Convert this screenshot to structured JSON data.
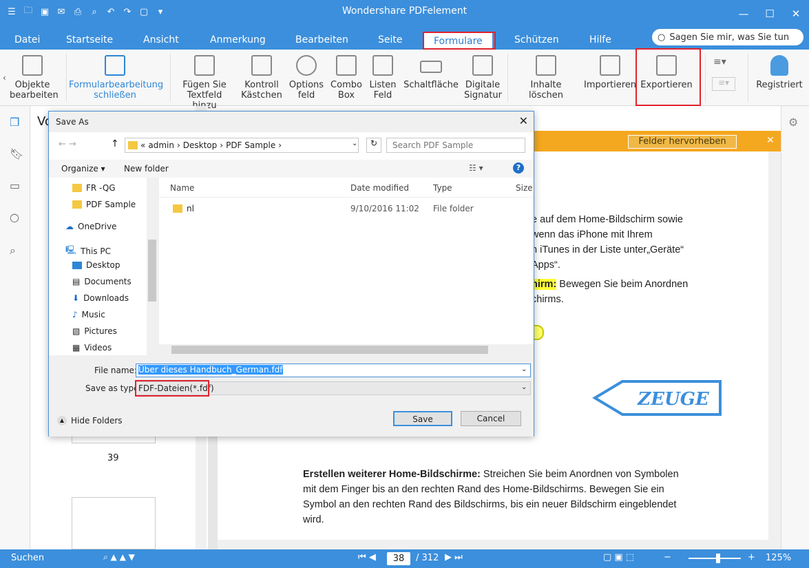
{
  "app": {
    "title": "Wondershare PDFelement",
    "tabs": [
      "Datei",
      "Startseite",
      "Ansicht",
      "Anmerkung",
      "Bearbeiten",
      "Seite",
      "Formulare",
      "Schützen",
      "Hilfe"
    ],
    "active_tab": "Formulare",
    "help_search_placeholder": "Sagen Sie mir, was Sie tun"
  },
  "ribbon": {
    "objekte": "Objekte bearbeiten",
    "formular_close": "Formularbearbeitung schließen",
    "textfeld": "Fügen Sie Textfeld hinzu",
    "kontroll": "Kontroll Kästchen",
    "options": "Options feld",
    "combo": "Combo Box",
    "listen": "Listen Feld",
    "schalt": "Schaltfläche",
    "signatur": "Digitale Signatur",
    "inhalte": "Inhalte löschen",
    "importieren": "Importieren",
    "exportieren": "Exportieren",
    "registriert": "Registriert"
  },
  "highlight_button": "Felder hervorheben",
  "thumbs": {
    "title": "Vo",
    "page_number": "39"
  },
  "doc": {
    "line1": "e auf dem Home-Bildschirm sowie",
    "line2": "wenn das iPhone mit Ihrem",
    "line3": "n iTunes in der Liste unter„Geräte“",
    "line4": "Apps“.",
    "line5_h": "hirm:",
    "line5": " Bewegen Sie beim Anordnen",
    "line6": "chirms.",
    "stamp": "ZEUGE",
    "para_bold": "Erstellen weiterer Home-Bildschirme:",
    "para1": " Streichen Sie beim Anordnen von Symbolen",
    "para2": "mit dem Finger bis an den rechten Rand des Home-Bildschirms. Bewegen Sie ein",
    "para3": "Symbol an den rechten Rand des Bildschirms, bis ein neuer Bildschirm eingeblendet",
    "para4": "wird."
  },
  "status": {
    "search": "Suchen",
    "page": "38",
    "total": "/ 312",
    "zoom": "125%"
  },
  "dialog": {
    "title": "Save As",
    "path": [
      "admin",
      "Desktop",
      "PDF Sample"
    ],
    "search_placeholder": "Search PDF Sample",
    "organize": "Organize",
    "new_folder": "New folder",
    "nav": [
      "FR -QG",
      "PDF Sample",
      "OneDrive",
      "This PC",
      "Desktop",
      "Documents",
      "Downloads",
      "Music",
      "Pictures",
      "Videos"
    ],
    "columns": [
      "Name",
      "Date modified",
      "Type",
      "Size"
    ],
    "files": [
      {
        "name": "nl",
        "date": "9/10/2016 11:02",
        "type": "File folder"
      }
    ],
    "file_name_label": "File name:",
    "file_name": "Über dieses Handbuch_German.fdf",
    "save_type_label": "Save as type:",
    "save_type": "FDF-Dateien(*.fdf)",
    "hide_folders": "Hide Folders",
    "save": "Save",
    "cancel": "Cancel"
  }
}
